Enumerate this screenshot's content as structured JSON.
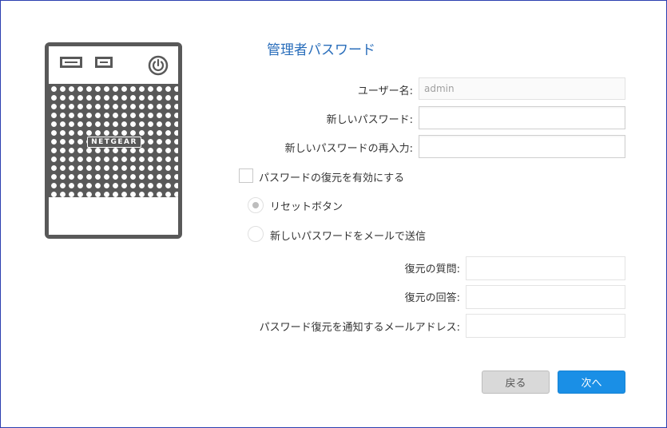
{
  "page": {
    "title": "管理者パスワード"
  },
  "device": {
    "brand": "NETGEAR",
    "icons": [
      "drive-bay-icon",
      "drive-bay-icon",
      "power-icon"
    ]
  },
  "form": {
    "username": {
      "label": "ユーザー名:",
      "value": "admin"
    },
    "new_password": {
      "label": "新しいパスワード:",
      "value": ""
    },
    "confirm_password": {
      "label": "新しいパスワードの再入力:",
      "value": ""
    },
    "enable_recovery": {
      "label": "パスワードの復元を有効にする",
      "checked": false
    },
    "recovery_options": [
      {
        "label": "リセットボタン",
        "selected": true
      },
      {
        "label": "新しいパスワードをメールで送信",
        "selected": false
      }
    ],
    "recovery_question": {
      "label": "復元の質問:",
      "value": ""
    },
    "recovery_answer": {
      "label": "復元の回答:",
      "value": ""
    },
    "recovery_email": {
      "label": "パスワード復元を通知するメールアドレス:",
      "value": ""
    }
  },
  "buttons": {
    "back": "戻る",
    "next": "次へ"
  },
  "colors": {
    "accent": "#2a6ebb",
    "primary_button": "#1a8fe6",
    "secondary_button": "#d9d9d9",
    "device_gray": "#595959",
    "frame_border": "#2c3fb0"
  }
}
